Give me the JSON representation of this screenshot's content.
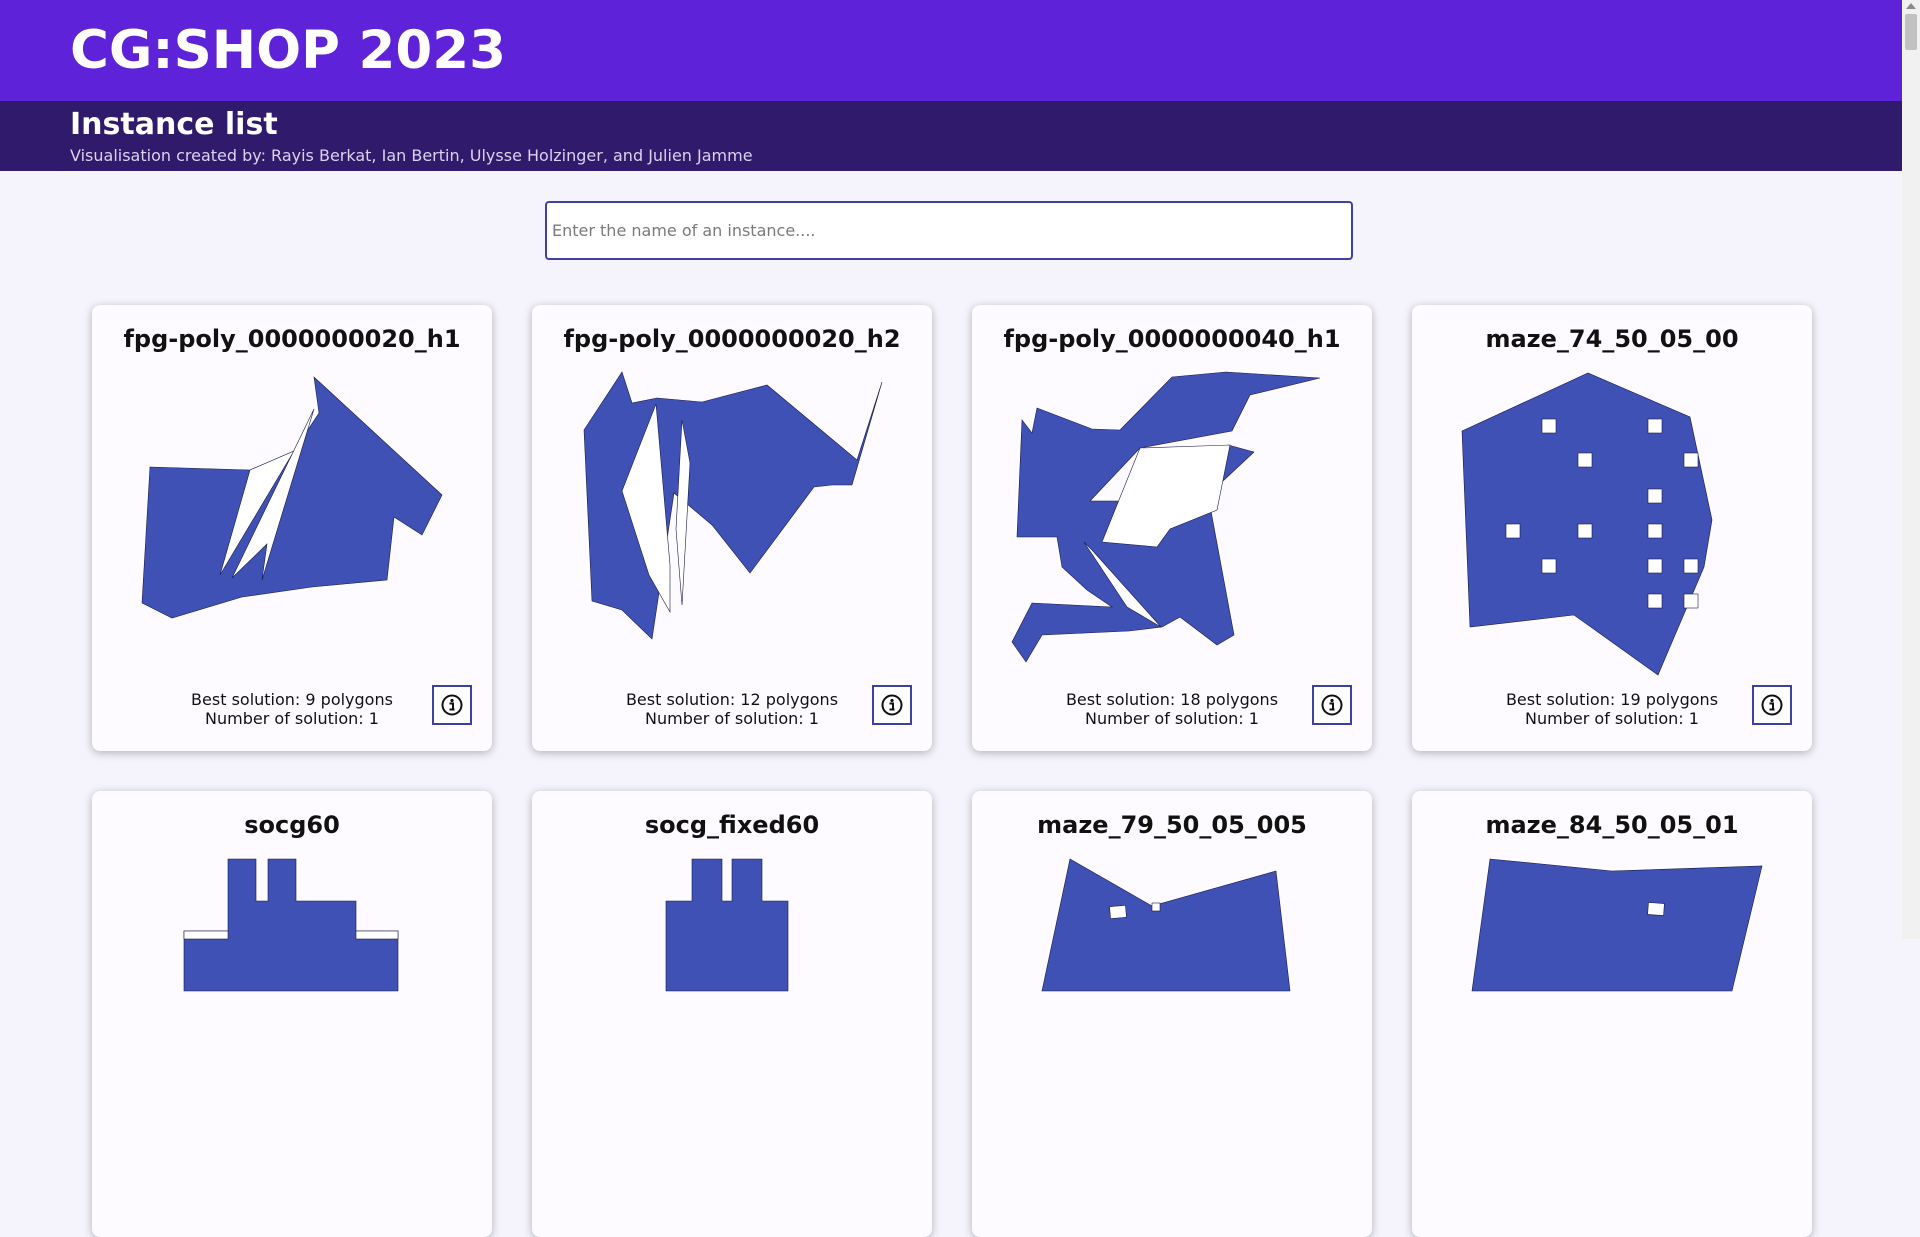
{
  "header": {
    "title": "CG:SHOP 2023",
    "subtitle": "Instance list",
    "credits": "Visualisation created by: Rayis Berkat, Ian Bertin, Ulysse Holzinger, and Julien Jamme"
  },
  "search": {
    "placeholder": "Enter the name of an instance...."
  },
  "colors": {
    "header_bg": "#5e22d8",
    "subheader_bg": "#301a6b",
    "polygon_fill": "#3f51b5",
    "page_bg": "#f5f4fd"
  },
  "cards": [
    {
      "name": "fpg-poly_0000000020_h1",
      "best": "Best solution: 9 polygons",
      "count": "Number of solution: 1",
      "icon": "info-icon"
    },
    {
      "name": "fpg-poly_0000000020_h2",
      "best": "Best solution: 12 polygons",
      "count": "Number of solution: 1",
      "icon": "info-icon"
    },
    {
      "name": "fpg-poly_0000000040_h1",
      "best": "Best solution: 18 polygons",
      "count": "Number of solution: 1",
      "icon": "info-icon"
    },
    {
      "name": "maze_74_50_05_00",
      "best": "Best solution: 19 polygons",
      "count": "Number of solution: 1",
      "icon": "info-icon"
    },
    {
      "name": "socg60"
    },
    {
      "name": "socg_fixed60"
    },
    {
      "name": "maze_79_50_05_005"
    },
    {
      "name": "maze_84_50_05_01"
    }
  ]
}
